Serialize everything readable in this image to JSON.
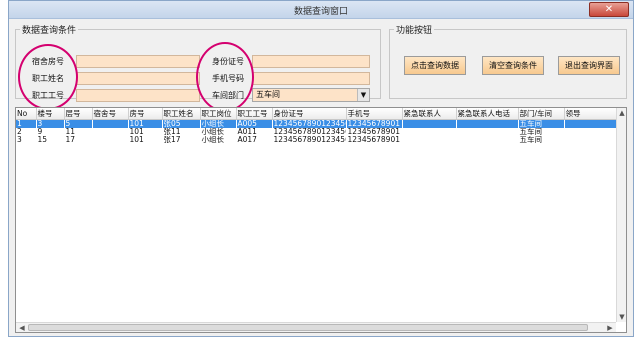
{
  "window": {
    "title": "数据查询窗口",
    "close_label": "✕"
  },
  "query_group": {
    "legend": "数据查询条件",
    "fields": [
      {
        "label": "宿舍房号",
        "value": ""
      },
      {
        "label": "职工姓名",
        "value": ""
      },
      {
        "label": "职工工号",
        "value": ""
      },
      {
        "label": "身份证号",
        "value": ""
      },
      {
        "label": "手机号码",
        "value": ""
      },
      {
        "label": "车间部门",
        "value": "五车间"
      }
    ]
  },
  "func_group": {
    "legend": "功能按钮",
    "buttons": [
      "点击查询数据",
      "清空查询条件",
      "退出查询界面"
    ]
  },
  "table": {
    "columns": [
      "No",
      "楼号",
      "层号",
      "宿舍号",
      "房号",
      "职工姓名",
      "职工岗位",
      "职工工号",
      "身份证号",
      "手机号",
      "紧急联系人",
      "紧急联系人电话",
      "部门/车间",
      "领导"
    ],
    "rows": [
      [
        "1",
        "3",
        "5",
        "",
        "101",
        "张05",
        "小组长",
        "A005",
        "123456789012345678",
        "12345678901",
        "",
        "",
        "五车间",
        ""
      ],
      [
        "2",
        "9",
        "11",
        "",
        "101",
        "张11",
        "小组长",
        "A011",
        "123456789012345678",
        "12345678901",
        "",
        "",
        "五车间",
        ""
      ],
      [
        "3",
        "15",
        "17",
        "",
        "101",
        "张17",
        "小组长",
        "A017",
        "123456789012345678",
        "12345678901",
        "",
        "",
        "五车间",
        ""
      ]
    ],
    "selected_row": 1
  },
  "colors": {
    "input_bg": "#fde3c8",
    "selection": "#3a8ee6",
    "annotation": "#d4006f"
  }
}
